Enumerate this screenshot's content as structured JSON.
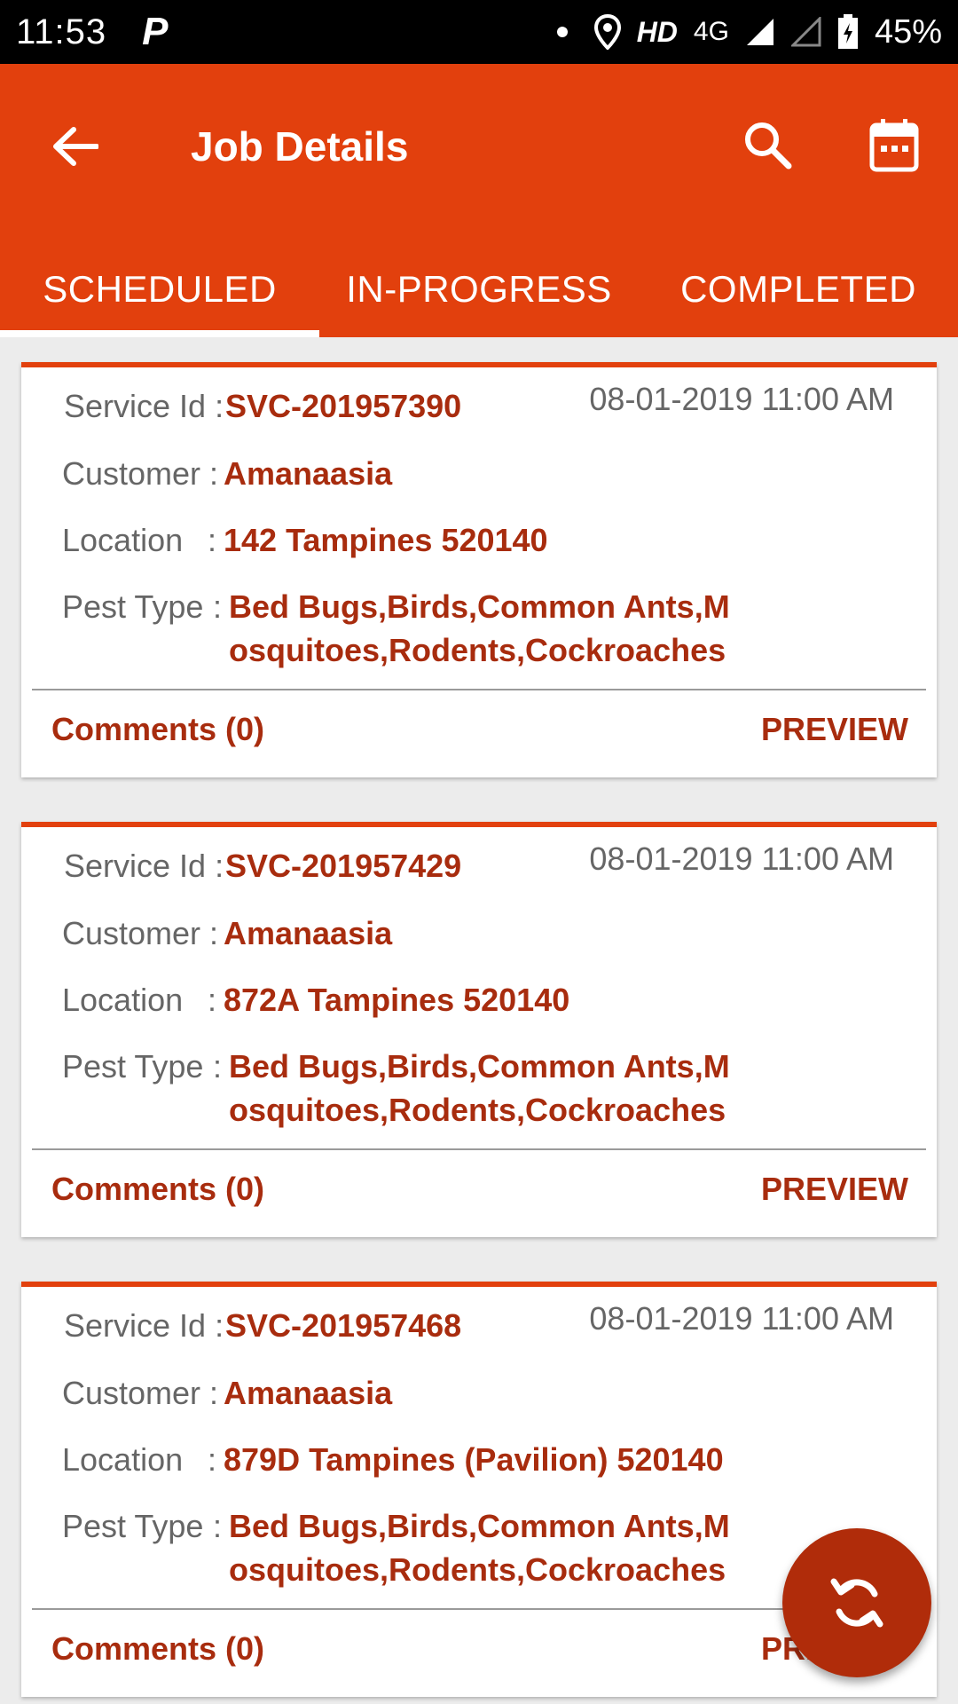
{
  "status_bar": {
    "time": "11:53",
    "app_indicator": "P",
    "network_label": "HD",
    "network_type": "4G",
    "battery": "45%"
  },
  "app_bar": {
    "title": "Job Details",
    "icons": [
      "back-arrow-icon",
      "search-icon",
      "calendar-icon"
    ],
    "color": "#e2400d"
  },
  "tabs": [
    {
      "label": "SCHEDULED",
      "active": true
    },
    {
      "label": "IN-PROGRESS",
      "active": false
    },
    {
      "label": "COMPLETED",
      "active": false
    }
  ],
  "labels": {
    "service_id": "Service Id :",
    "customer": "Customer :",
    "location": "Location",
    "location_colon": ":",
    "pest_type": "Pest Type",
    "pest_colon": ":"
  },
  "jobs": [
    {
      "service_id": "SVC-201957390",
      "datetime": "08-01-2019 11:00 AM",
      "customer": "Amanaasia",
      "location": "142 Tampines 520140",
      "pest_line1": "Bed Bugs,Birds,Common Ants,M",
      "pest_line2": "osquitoes,Rodents,Cockroaches",
      "comments": "Comments (0)",
      "preview": "PREVIEW"
    },
    {
      "service_id": "SVC-201957429",
      "datetime": "08-01-2019 11:00 AM",
      "customer": "Amanaasia",
      "location": "872A Tampines 520140",
      "pest_line1": "Bed Bugs,Birds,Common Ants,M",
      "pest_line2": "osquitoes,Rodents,Cockroaches",
      "comments": "Comments (0)",
      "preview": "PREVIEW"
    },
    {
      "service_id": "SVC-201957468",
      "datetime": "08-01-2019 11:00 AM",
      "customer": "Amanaasia",
      "location": "879D Tampines (Pavilion) 520140",
      "pest_line1": "Bed Bugs,Birds,Common Ants,M",
      "pest_line2": "osquitoes,Rodents,Cockroaches",
      "comments": "Comments (0)",
      "preview": "PREVIEW"
    }
  ],
  "fab": {
    "icon": "sync-icon",
    "color": "#b02c0a"
  }
}
